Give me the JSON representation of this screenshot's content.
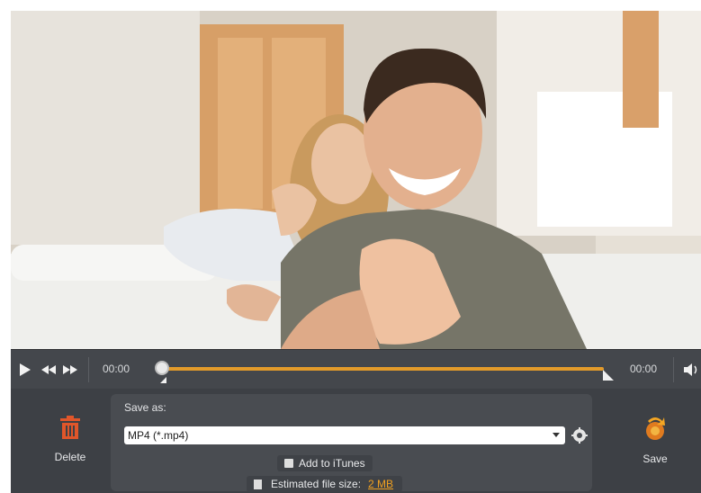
{
  "playback": {
    "current_time": "00:00",
    "total_time": "00:00",
    "progress": 0
  },
  "save_as": {
    "label": "Save as:",
    "format": "MP4 (*.mp4)",
    "add_to_itunes": "Add to iTunes",
    "estimate_label": "Estimated file size:",
    "estimate_value": "2 MB"
  },
  "actions": {
    "delete": "Delete",
    "save": "Save"
  },
  "colors": {
    "accent": "#e39b2a",
    "panel": "#3d4045",
    "delete_icon": "#e0562a"
  },
  "icons": [
    "play-icon",
    "rewind-icon",
    "fast-forward-icon",
    "volume-icon",
    "trash-icon",
    "settings-gear-icon",
    "save-icon"
  ]
}
